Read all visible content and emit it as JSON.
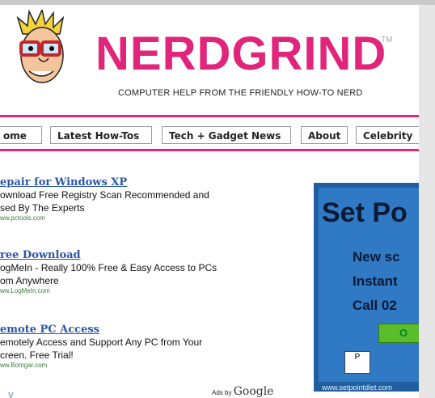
{
  "header": {
    "logo": "NERDGRIND",
    "tm": "TM",
    "tagline": "COMPUTER HELP FROM THE FRIENDLY HOW-TO NERD"
  },
  "nav": {
    "items": [
      "ome",
      "Latest How-Tos",
      "Tech + Gadget News",
      "About",
      "Celebrity"
    ]
  },
  "ads": {
    "items": [
      {
        "title": "epair for Windows XP",
        "desc1": "ownload Free Registry Scan Recommended and",
        "desc2": "sed By The Experts",
        "url": "ww.pctools.com"
      },
      {
        "title": "ree Download",
        "desc1": "ogMeIn - Really 100% Free & Easy Access to PCs",
        "desc2": "om Anywhere",
        "url": "ww.LogMeIn.com"
      },
      {
        "title": "emote PC Access",
        "desc1": "emotely Access and Support Any PC from Your",
        "desc2": "creen. Free Trial!",
        "url": "ww.Bomgar.com"
      }
    ],
    "ads_by": "Ads by",
    "google": "Google",
    "corner_glyph": "V"
  },
  "banner": {
    "headline": "Set Po",
    "line1": "New sc",
    "line2": "Instant",
    "line3": "Call 02",
    "button": "O",
    "logo": "P",
    "url": "www.setpointdiet.com"
  },
  "colors": {
    "brand_pink": "#e0257b",
    "ad_link_blue": "#2c56a8",
    "banner_blue": "#3079c5"
  }
}
